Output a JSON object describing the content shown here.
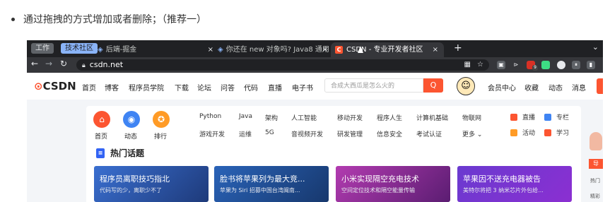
{
  "caption": {
    "text": "通过拖拽的方式增加或者删除；（推荐一）"
  },
  "browser": {
    "tab_groups": [
      {
        "label": "工作"
      },
      {
        "label": "技术社区"
      }
    ],
    "tabs": [
      {
        "title": "后端-掘金",
        "close": "×"
      },
      {
        "title": "你还在 new 对象吗? Java8 通用",
        "close": "×"
      },
      {
        "favicon": "C",
        "title": "CSDN - 专业开发者社区",
        "close": "×"
      }
    ],
    "new_tab": "+",
    "url": "csdn.net",
    "ext_badge": "9",
    "tab_menu": "⌄"
  },
  "site": {
    "logo": {
      "mark": "⊙",
      "text": "CSDN"
    },
    "nav": [
      "首页",
      "博客",
      "程序员学院",
      "下载",
      "论坛",
      "问答",
      "代码",
      "直播",
      "电子书"
    ],
    "search_placeholder": "合成大西瓜是怎么火的",
    "search_icon": "Q",
    "user_links": [
      "会员中心",
      "收藏",
      "动态",
      "消息"
    ],
    "quick": [
      {
        "label": "首页",
        "icon": "⌂",
        "color": "#fc5531"
      },
      {
        "label": "动态",
        "icon": "◉",
        "color": "#3f84f3"
      },
      {
        "label": "排行",
        "icon": "✪",
        "color": "#ff9b26"
      }
    ],
    "categories_row1": [
      "Python",
      "Java",
      "架构",
      "人工智能",
      "移动开发",
      "程序人生",
      "计算机基础",
      "物联网"
    ],
    "categories_row2": [
      "游戏开发",
      "运维",
      "5G",
      "音视频开发",
      "研发管理",
      "信息安全",
      "考试认证",
      "更多 ⌄"
    ],
    "right_links_row1": [
      "直播",
      "专栏"
    ],
    "right_links_row2": [
      "活动",
      "学习"
    ],
    "hot_title": "热门话题",
    "banners": [
      {
        "title": "程序员离职技巧指北",
        "subtitle": "代码写的少，离职少不了"
      },
      {
        "title": "脸书将苹果列为最大竞...",
        "subtitle": "苹果为 Siri 招募中国台湾闽南..."
      },
      {
        "title": "小米实现隔空充电技术",
        "subtitle": "空间定位技术和隔空能量传输"
      },
      {
        "title": "苹果因不送充电器被告",
        "subtitle": "美特尔将把 3 纳米芯片外包给..."
      }
    ],
    "side_guide": "导",
    "side_text1": "热门",
    "side_text2": "精彩"
  }
}
